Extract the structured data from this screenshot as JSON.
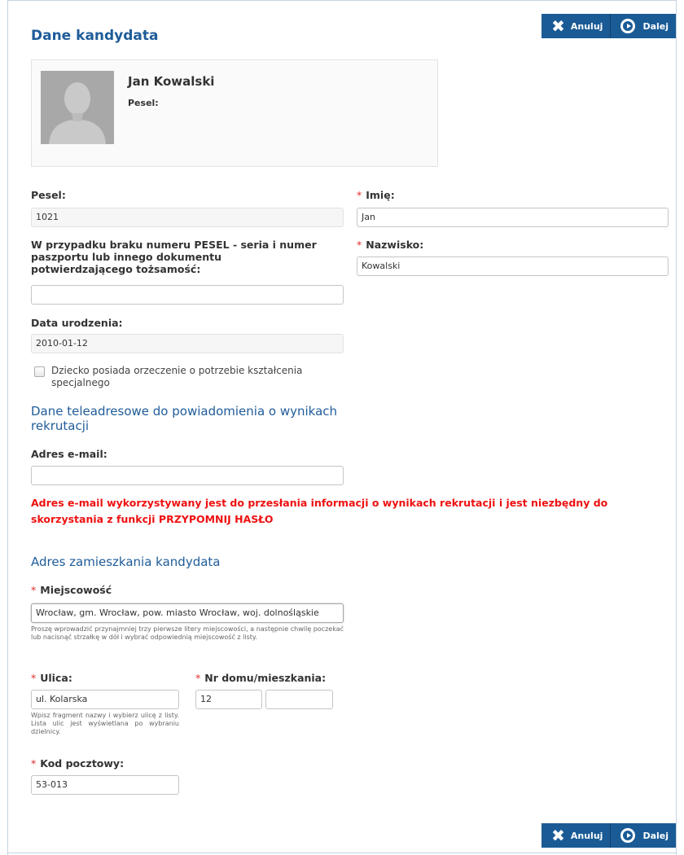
{
  "buttons": {
    "cancel_label": "Anuluj",
    "next_label": "Dalej"
  },
  "title": "Dane kandydata",
  "card": {
    "name": "Jan Kowalski",
    "pesel_label": "Pesel:"
  },
  "form": {
    "pesel": {
      "label": "Pesel:",
      "value": "1021"
    },
    "imie": {
      "label": "Imię:",
      "value": "Jan"
    },
    "nazwisko": {
      "label": "Nazwisko:",
      "value": "Kowalski"
    },
    "passport": {
      "label": "W przypadku braku numeru PESEL - seria i numer paszportu lub innego dokumentu potwierdzającego tożsamość:",
      "value": ""
    },
    "birthdate": {
      "label": "Data urodzenia:",
      "value": "2010-01-12"
    },
    "special_needs": {
      "label": "Dziecko posiada orzeczenie o potrzebie kształcenia specjalnego",
      "checked": false
    }
  },
  "contact": {
    "title": "Dane teleadresowe do powiadomienia o wynikach rekrutacji",
    "email_label": "Adres e-mail:",
    "email_value": "",
    "email_note": "Adres e-mail wykorzystywany jest do przesłania informacji o wynikach rekrutacji i jest niezbędny do skorzystania z funkcji PRZYPOMNIJ HASŁO"
  },
  "address": {
    "title": "Adres zamieszkania kandydata",
    "city_label": "Miejscowość",
    "city_value": "Wrocław, gm. Wrocław, pow. miasto Wrocław, woj. dolnośląskie",
    "city_hint": "Proszę wprowadzić przynajmniej trzy pierwsze litery miejscowości, a następnie chwilę poczekać lub nacisnąć strzałkę w dół i wybrać odpowiednią miejscowość z listy.",
    "street_label": "Ulica:",
    "street_value": "ul. Kolarska",
    "street_hint": "Wpisz fragment nazwy i wybierz ulicę z listy. Lista ulic jest wyświetlana po wybraniu dzielnicy.",
    "house_label": "Nr domu/mieszkania:",
    "house_value": "12",
    "flat_value": "",
    "postal_label": "Kod pocztowy:",
    "postal_value": "53-013"
  },
  "required_marker": "*"
}
